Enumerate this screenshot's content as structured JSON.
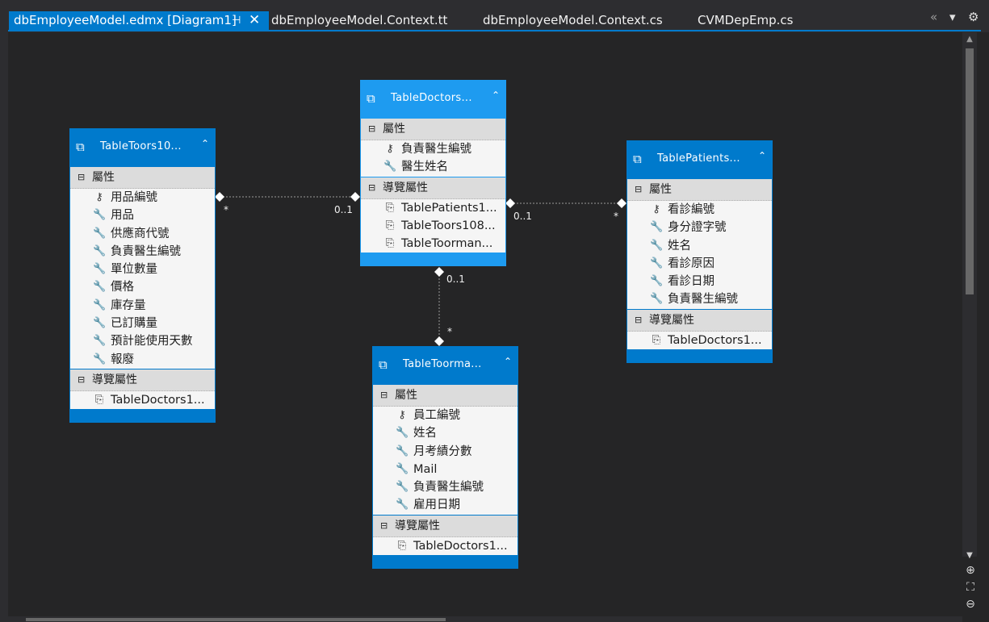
{
  "tabs": [
    {
      "label": "dbEmployeeModel.edmx [Diagram1]",
      "active": true
    },
    {
      "label": "dbEmployeeModel.Context.tt"
    },
    {
      "label": "dbEmployeeModel.Context.cs"
    },
    {
      "label": "CVMDepEmp.cs"
    }
  ],
  "glyphs": {
    "pin": "⊣",
    "close": "✕",
    "collapse": "⌃",
    "minus": "⊟",
    "key": "⚷",
    "prop": "🔧",
    "nav": "⎘",
    "entity": "⧉",
    "diamond": "◇",
    "chevrons": "«",
    "dropdown": "▾",
    "gear": "⚙"
  },
  "entities": {
    "toors": {
      "title": "TableToors10...",
      "props_label": "屬性",
      "props": [
        "用品編號",
        "用品",
        "供應商代號",
        "負責醫生編號",
        "單位數量",
        "價格",
        "庫存量",
        "已訂購量",
        "預計能使用天數",
        "報廢"
      ],
      "nav_label": "導覽屬性",
      "nav": [
        "TableDoctors1..."
      ]
    },
    "doctors": {
      "title": "TableDoctors...",
      "props_label": "屬性",
      "props": [
        "負責醫生編號",
        "醫生姓名"
      ],
      "nav_label": "導覽屬性",
      "nav": [
        "TablePatients1...",
        "TableToors108...",
        "TableToorman..."
      ]
    },
    "patients": {
      "title": "TablePatients...",
      "props_label": "屬性",
      "props": [
        "看診編號",
        "身分證字號",
        "姓名",
        "看診原因",
        "看診日期",
        "負責醫生編號"
      ],
      "nav_label": "導覽屬性",
      "nav": [
        "TableDoctors1..."
      ]
    },
    "toorman": {
      "title": "TableToorma...",
      "props_label": "屬性",
      "props": [
        "員工編號",
        "姓名",
        "月考績分數",
        "Mail",
        "負責醫生編號",
        "雇用日期"
      ],
      "nav_label": "導覽屬性",
      "nav": [
        "TableDoctors1..."
      ]
    }
  },
  "multiplicities": {
    "toors_many": "*",
    "toors_doc": "0..1",
    "pat_doc": "0..1",
    "pat_many": "*",
    "man_doc": "0..1",
    "man_many": "*"
  }
}
